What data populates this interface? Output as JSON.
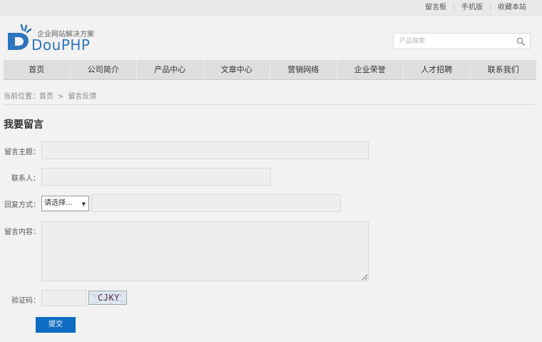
{
  "top_links": [
    "留言板",
    "手机版",
    "收藏本站"
  ],
  "logo": {
    "tagline": "企业网站解决方案",
    "name": "DouPHP"
  },
  "search": {
    "placeholder": "产品搜索"
  },
  "nav": [
    "首页",
    "公司简介",
    "产品中心",
    "文章中心",
    "营销网络",
    "企业荣誉",
    "人才招聘",
    "联系我们"
  ],
  "breadcrumb": {
    "prefix": "当前位置：",
    "home": "首页",
    "arrow": ">",
    "current": "留言反馈"
  },
  "page_title": "我要留言",
  "form": {
    "subject_label": "留言主题：",
    "contact_label": "联系人：",
    "reply_label": "回复方式：",
    "reply_select": "请选择...",
    "content_label": "留言内容：",
    "captcha_label": "验证码：",
    "captcha_text": "CJKY",
    "submit_label": "提交"
  },
  "colors": {
    "brand": "#2d74be",
    "submit": "#0e6cc2"
  }
}
